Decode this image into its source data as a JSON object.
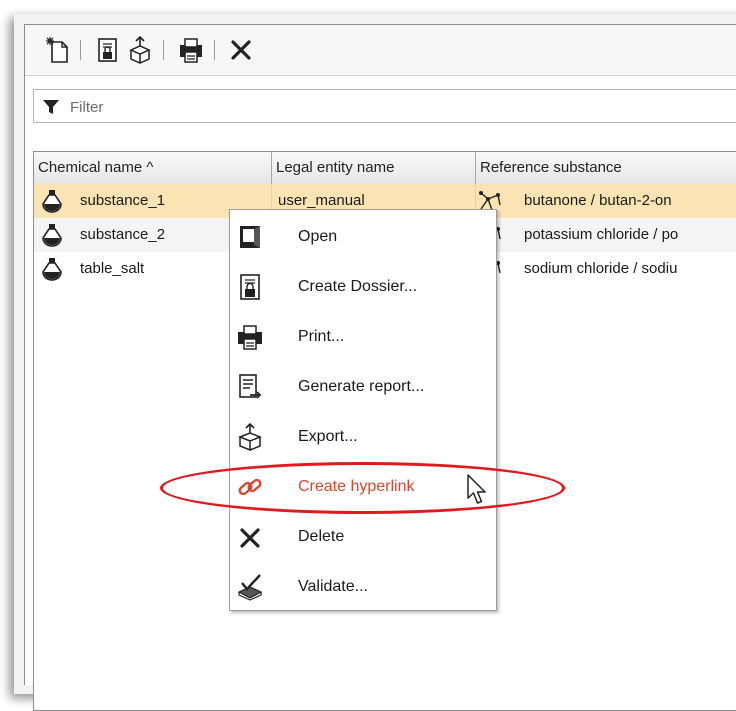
{
  "toolbar": {
    "buttons": [
      {
        "name": "new-icon"
      },
      {
        "name": "create-dossier-icon"
      },
      {
        "name": "export-icon"
      },
      {
        "name": "print-icon"
      },
      {
        "name": "delete-icon"
      }
    ]
  },
  "filter": {
    "placeholder": "Filter",
    "value": ""
  },
  "table": {
    "columns": [
      "Chemical name ^",
      "Legal entity name",
      "Reference substance"
    ],
    "rows": [
      {
        "chemical_name": "substance_1",
        "legal_entity": "user_manual",
        "reference": "butanone / butan-2-on"
      },
      {
        "chemical_name": "substance_2",
        "legal_entity": "",
        "reference": "potassium chloride / po"
      },
      {
        "chemical_name": "table_salt",
        "legal_entity": "",
        "reference": "sodium chloride / sodiu"
      }
    ]
  },
  "context_menu": {
    "items": [
      {
        "label": "Open",
        "icon": "open-icon"
      },
      {
        "label": "Create Dossier...",
        "icon": "create-dossier-icon"
      },
      {
        "label": "Print...",
        "icon": "print-icon"
      },
      {
        "label": "Generate report...",
        "icon": "report-icon"
      },
      {
        "label": "Export...",
        "icon": "export-icon"
      },
      {
        "label": "Create hyperlink",
        "icon": "link-icon"
      },
      {
        "label": "Delete",
        "icon": "delete-icon"
      },
      {
        "label": "Validate...",
        "icon": "validate-icon"
      }
    ]
  },
  "colors": {
    "selection": "#fbe4b4",
    "highlight_text": "#d24a32",
    "callout": "#e0191f"
  }
}
